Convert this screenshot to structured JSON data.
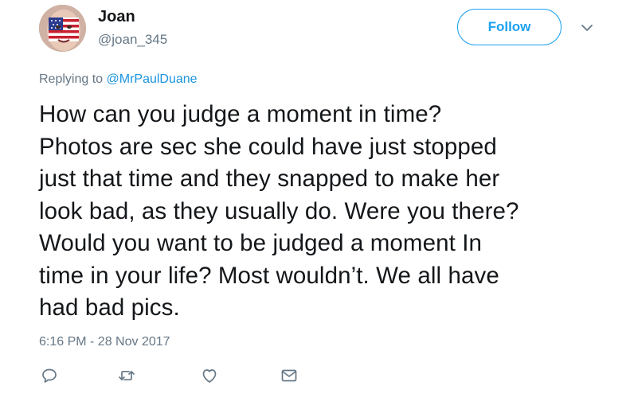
{
  "author": {
    "display_name": "Joan",
    "handle": "@joan_345"
  },
  "follow_button": {
    "label": "Follow"
  },
  "reply_context": {
    "prefix": "Replying to ",
    "mention": "@MrPaulDuane"
  },
  "tweet": {
    "text": "How can you judge a moment in time?\nPhotos are sec she could have just stopped\njust that time and they snapped to make her\nlook bad, as they usually do.  Were you there?\nWould you want to be judged a moment In\ntime in your life?  Most wouldn’t.  We all have\nhad bad pics.",
    "timestamp": "6:16 PM - 28 Nov 2017"
  },
  "actions": {
    "reply_icon": "speech-bubble-icon",
    "retweet_icon": "retweet-arrows-icon",
    "like_icon": "heart-icon",
    "dm_icon": "envelope-icon"
  },
  "colors": {
    "brand": "#1da1f2",
    "link": "#1b95e0",
    "secondary_text": "#657786",
    "primary_text": "#14171a"
  }
}
